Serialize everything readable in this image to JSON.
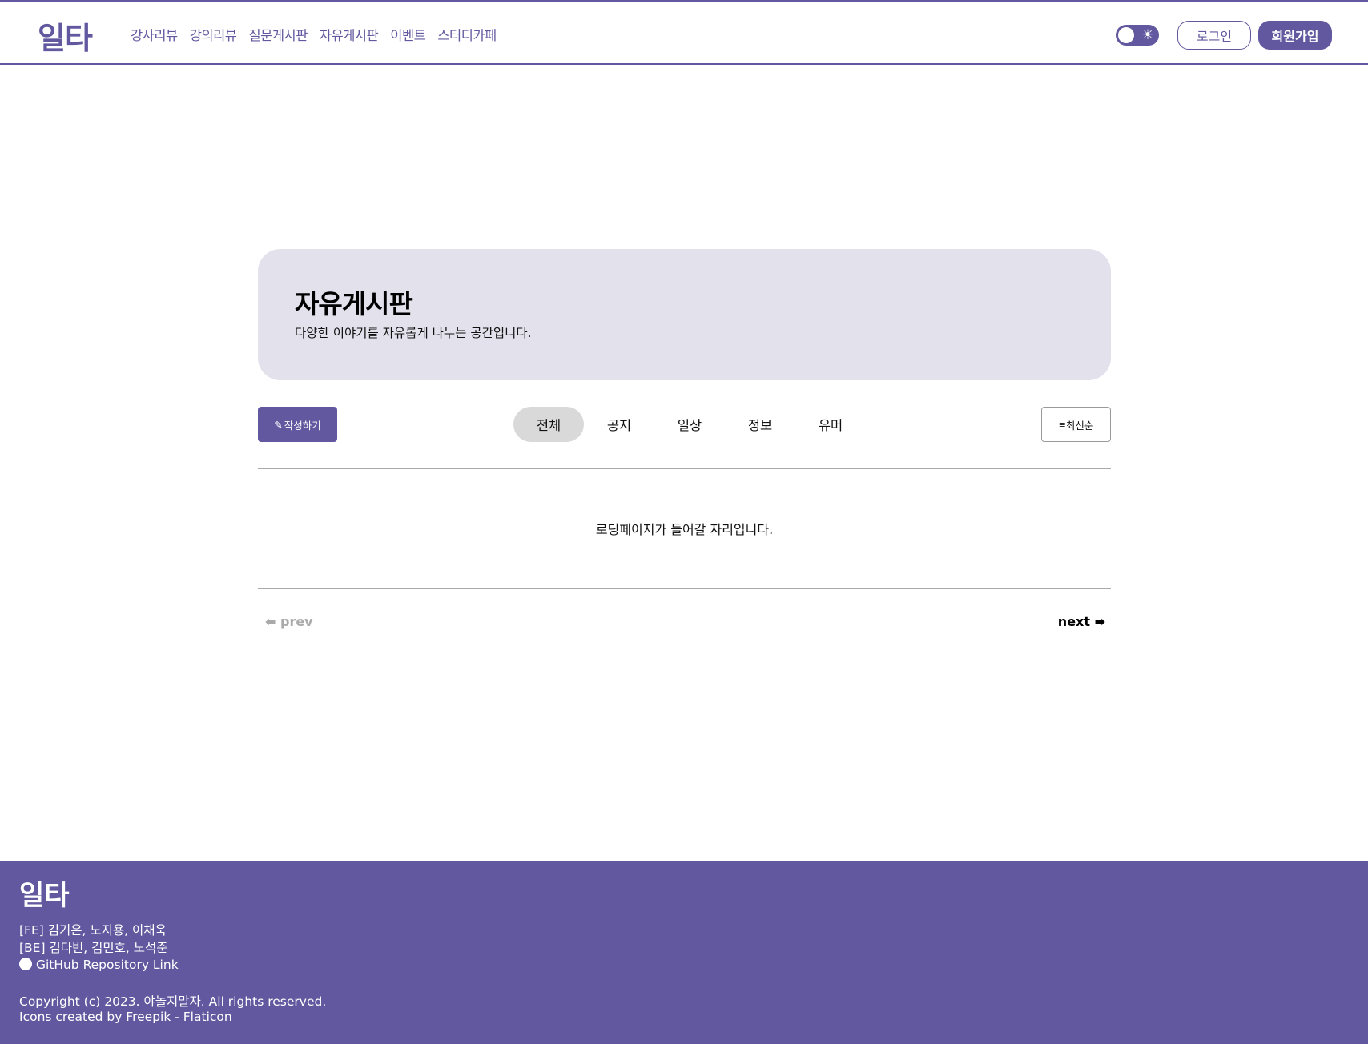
{
  "header": {
    "logo": "일타",
    "nav": [
      "강사리뷰",
      "강의리뷰",
      "질문게시판",
      "자유게시판",
      "이벤트",
      "스터디카페"
    ],
    "login": "로그인",
    "signup": "회원가입",
    "theme_icon": "sun-icon"
  },
  "banner": {
    "title": "자유게시판",
    "subtitle": "다양한 이야기를 자유롭게 나누는 공간입니다."
  },
  "toolbar": {
    "write": "작성하기",
    "tabs": [
      "전체",
      "공지",
      "일상",
      "정보",
      "유머"
    ],
    "active_tab": "전체",
    "sort": "최신순"
  },
  "content": {
    "loading": "로딩페이지가 들어갈 자리입니다."
  },
  "pagination": {
    "prev": "prev",
    "next": "next"
  },
  "footer": {
    "logo": "일타",
    "fe": "[FE] 김기은, 노지용, 이채욱",
    "be": "[BE] 김다빈, 김민호, 노석준",
    "github": "GitHub Repository Link",
    "copyright": "Copyright (c) 2023. 야놀지말자. All rights reserved.",
    "icons": "Icons created by Freepik - Flaticon"
  },
  "colors": {
    "brand": "#62589f",
    "banner": "#e3e1ec"
  }
}
